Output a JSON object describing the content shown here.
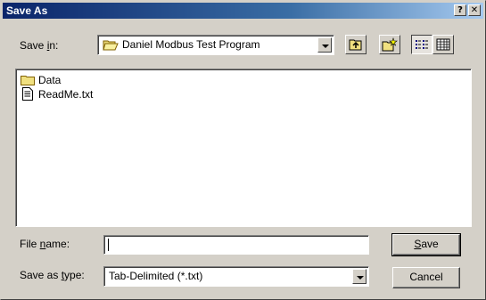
{
  "window": {
    "title": "Save As"
  },
  "titlebar": {
    "help_glyph": "?",
    "close_glyph": "✕"
  },
  "toolbar": {
    "save_in_label_pre": "Save ",
    "save_in_label_key": "i",
    "save_in_label_post": "n:",
    "location": "Daniel Modbus Test Program",
    "buttons": [
      "up-one-level-icon",
      "create-new-folder-icon",
      "list-view-icon",
      "details-view-icon"
    ]
  },
  "files": [
    {
      "name": "Data",
      "icon": "folder-icon"
    },
    {
      "name": "ReadMe.txt",
      "icon": "text-file-icon"
    }
  ],
  "form": {
    "file_name_pre": "File ",
    "file_name_key": "n",
    "file_name_post": "ame:",
    "file_name_value": "",
    "save_type_pre": "Save as ",
    "save_type_key": "t",
    "save_type_post": "ype:",
    "save_type_value": "Tab-Delimited (*.txt)"
  },
  "buttons": {
    "save_key": "S",
    "save_rest": "ave",
    "cancel": "Cancel"
  },
  "colors": {
    "titlebar_start": "#0a246a",
    "titlebar_end": "#a6caf0",
    "face": "#d4d0c8"
  }
}
